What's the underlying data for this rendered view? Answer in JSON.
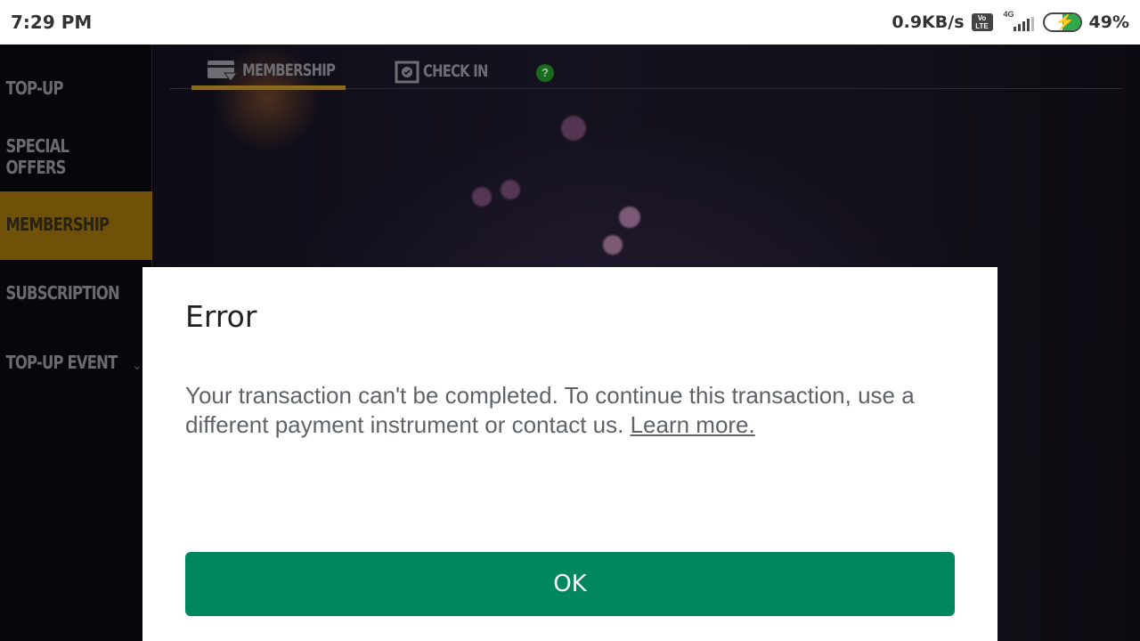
{
  "status_bar": {
    "time": "7:29 PM",
    "network_speed": "0.9KB/s",
    "volte_label": "Vo LTE",
    "network_type": "4G",
    "battery_percent": "49%",
    "battery_level": 0.49,
    "charging": true
  },
  "sidebar": {
    "items": [
      {
        "label": "TOP-UP",
        "active": false
      },
      {
        "label": "SPECIAL OFFERS",
        "active": false
      },
      {
        "label": "MEMBERSHIP",
        "active": true
      },
      {
        "label": "SUBSCRIPTION",
        "active": false
      },
      {
        "label": "TOP-UP EVENT",
        "active": false,
        "expandable": true
      }
    ],
    "active_color": "#6f5207"
  },
  "tabs": {
    "items": [
      {
        "label": "MEMBERSHIP",
        "icon": "membership-card-icon",
        "active": true
      },
      {
        "label": "CHECK IN",
        "icon": "check-in-calendar-icon",
        "active": false
      }
    ],
    "help_label": "?"
  },
  "dialog": {
    "title": "Error",
    "message": "Your transaction can't be completed. To continue this transaction, use a different payment instrument or contact us.",
    "link_text": "Learn more.",
    "ok_label": "OK",
    "button_color": "#01875f"
  }
}
